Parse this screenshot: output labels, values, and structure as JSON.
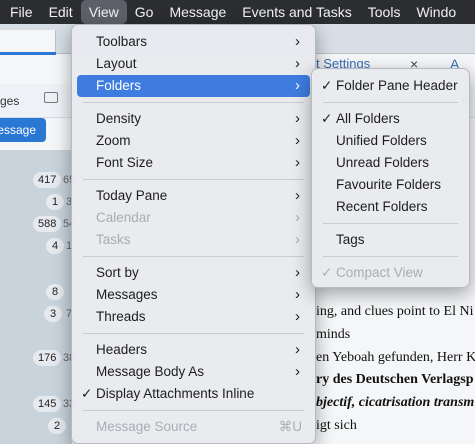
{
  "menubar": {
    "items": [
      "File",
      "Edit",
      "View",
      "Go",
      "Message",
      "Events and Tasks",
      "Tools",
      "Windo"
    ],
    "active": "View"
  },
  "tabs": {
    "settings_label": "t Settings",
    "close_glyph": "×",
    "right_label": "A"
  },
  "toolbar": {
    "left_label": "ges",
    "write_label": "essage",
    "right_label": "F"
  },
  "folder_counts": [
    {
      "badge": "417",
      "small": "65"
    },
    {
      "badge": "1",
      "small": "3"
    },
    {
      "badge": "588",
      "small": "54"
    },
    {
      "badge": "4",
      "small": "1"
    },
    {
      "badge": "8",
      "small": ""
    },
    {
      "badge": "3",
      "small": "7"
    },
    {
      "badge": "176",
      "small": "38"
    },
    {
      "badge": "145",
      "small": "33"
    },
    {
      "badge": "2",
      "small": ""
    }
  ],
  "message_list": [
    {
      "text": "ing, and clues point to El Ni",
      "style": "normal"
    },
    {
      "text": "minds",
      "style": "normal"
    },
    {
      "text": "en Yeboah gefunden, Herr K",
      "style": "normal"
    },
    {
      "text": "ry des Deutschen Verlagsp",
      "style": "bold"
    },
    {
      "text": "bjectif, cicatrisation transm",
      "style": "bi"
    },
    {
      "text": "igt sich",
      "style": "normal"
    }
  ],
  "view_menu": {
    "items": [
      {
        "label": "Toolbars",
        "submenu": true
      },
      {
        "label": "Layout",
        "submenu": true
      },
      {
        "label": "Folders",
        "submenu": true,
        "selected": true
      },
      {
        "separator": true
      },
      {
        "label": "Density",
        "submenu": true
      },
      {
        "label": "Zoom",
        "submenu": true
      },
      {
        "label": "Font Size",
        "submenu": true
      },
      {
        "separator": true
      },
      {
        "label": "Today Pane",
        "submenu": true
      },
      {
        "label": "Calendar",
        "submenu": true,
        "disabled": true
      },
      {
        "label": "Tasks",
        "submenu": true,
        "disabled": true
      },
      {
        "separator": true
      },
      {
        "label": "Sort by",
        "submenu": true
      },
      {
        "label": "Messages",
        "submenu": true
      },
      {
        "label": "Threads",
        "submenu": true
      },
      {
        "separator": true
      },
      {
        "label": "Headers",
        "submenu": true
      },
      {
        "label": "Message Body As",
        "submenu": true
      },
      {
        "label": "Display Attachments Inline",
        "checked": true
      },
      {
        "separator": true
      },
      {
        "label": "Message Source",
        "disabled": true,
        "shortcut": "⌘U"
      }
    ]
  },
  "folders_submenu": {
    "items": [
      {
        "label": "Folder Pane Header",
        "checked": true
      },
      {
        "separator": true
      },
      {
        "label": "All Folders",
        "checked": true
      },
      {
        "label": "Unified Folders"
      },
      {
        "label": "Unread Folders"
      },
      {
        "label": "Favourite Folders"
      },
      {
        "label": "Recent Folders"
      },
      {
        "separator": true
      },
      {
        "label": "Tags"
      },
      {
        "separator": true
      },
      {
        "label": "Compact View",
        "checked": true,
        "disabled": true
      }
    ]
  },
  "glyphs": {
    "chevron": "›",
    "check": "✓"
  },
  "colors": {
    "accent": "#3e7ce0",
    "menubar": "#2b2d31",
    "write_button": "#2a78d4"
  }
}
